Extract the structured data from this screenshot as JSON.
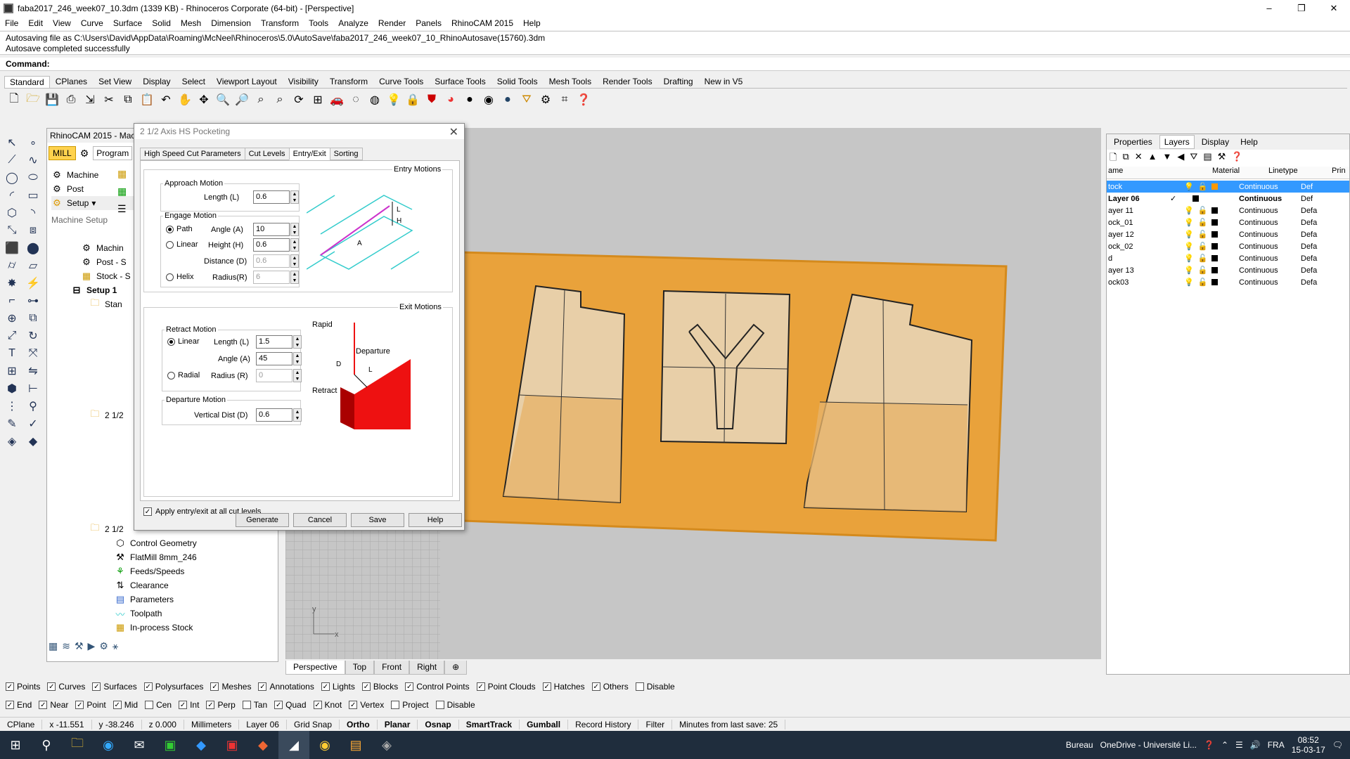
{
  "window": {
    "title": "faba2017_246_week07_10.3dm (1339 KB) - Rhinoceros Corporate (64-bit) - [Perspective]",
    "minimize": "–",
    "restore": "❐",
    "close": "✕"
  },
  "menu": [
    "File",
    "Edit",
    "View",
    "Curve",
    "Surface",
    "Solid",
    "Mesh",
    "Dimension",
    "Transform",
    "Tools",
    "Analyze",
    "Render",
    "Panels",
    "RhinoCAM 2015",
    "Help"
  ],
  "command_history": [
    "Autosaving file as C:\\Users\\David\\AppData\\Roaming\\McNeel\\Rhinoceros\\5.0\\AutoSave\\faba2017_246_week07_10_RhinoAutosave(15760).3dm",
    "Autosave completed successfully"
  ],
  "command_prompt": "Command:",
  "toolbar_tabs": [
    "Standard",
    "CPlanes",
    "Set View",
    "Display",
    "Select",
    "Viewport Layout",
    "Visibility",
    "Transform",
    "Curve Tools",
    "Surface Tools",
    "Solid Tools",
    "Mesh Tools",
    "Render Tools",
    "Drafting",
    "New in V5"
  ],
  "toolbar_icons": [
    "new-file-icon",
    "open-folder-icon",
    "save-icon",
    "print-icon",
    "import-icon",
    "cut-icon",
    "copy-icon",
    "paste-icon",
    "undo-icon",
    "pan-hand-icon",
    "move-icon",
    "zoom-icon",
    "zoom-window-icon",
    "zoom-extents-icon",
    "zoom-selected-icon",
    "rotate-view-icon",
    "four-viewports-icon",
    "car-icon",
    "hide-icon",
    "show-icon",
    "lightbulb-icon",
    "lock-icon",
    "shield-icon",
    "color-wheel-icon",
    "sphere-icon",
    "render-icon",
    "globe-icon",
    "filter-icon",
    "gear-icon",
    "grid-tools-icon",
    "help-icon"
  ],
  "rhinocam": {
    "title": "RhinoCAM 2015 - Mac",
    "mode_mill": "MILL",
    "tab_program": "Program",
    "machine": "Machine",
    "post": "Post",
    "setup": "Setup",
    "group_label": "Machine Setup",
    "tree_top": [
      "Machin",
      "Post - S",
      "Stock - S"
    ],
    "setup1": "Setup 1",
    "stan": "Stan",
    "node_21a": "2 1/2",
    "node_21b": "2 1/2",
    "tree_bottom": [
      "Control Geometry",
      "FlatMill 8mm_246",
      "Feeds/Speeds",
      "Clearance",
      "Parameters",
      "Toolpath",
      "In-process Stock"
    ]
  },
  "viewport_tabs": [
    "Perspective",
    "Top",
    "Front",
    "Right"
  ],
  "viewport_add": "⊕",
  "axis_y": "y",
  "axis_x": "x",
  "right_panel": {
    "tabs": [
      "Properties",
      "Layers",
      "Display",
      "Help"
    ],
    "columns": {
      "name": "ame",
      "material": "Material",
      "linetype": "Linetype",
      "print": "Prin"
    },
    "layers": [
      {
        "name": "tock",
        "linetype": "Continuous",
        "print": "Def"
      },
      {
        "name": "Layer 06",
        "linetype": "Continuous",
        "print": "Def"
      },
      {
        "name": "ayer 11",
        "linetype": "Continuous",
        "print": "Defa"
      },
      {
        "name": "ock_01",
        "linetype": "Continuous",
        "print": "Defa"
      },
      {
        "name": "ayer 12",
        "linetype": "Continuous",
        "print": "Defa"
      },
      {
        "name": "ock_02",
        "linetype": "Continuous",
        "print": "Defa"
      },
      {
        "name": "d",
        "linetype": "Continuous",
        "print": "Defa"
      },
      {
        "name": "ayer 13",
        "linetype": "Continuous",
        "print": "Defa"
      },
      {
        "name": "ock03",
        "linetype": "Continuous",
        "print": "Defa"
      }
    ]
  },
  "visibility_filters": [
    {
      "label": "Points",
      "checked": true
    },
    {
      "label": "Curves",
      "checked": true
    },
    {
      "label": "Surfaces",
      "checked": true
    },
    {
      "label": "Polysurfaces",
      "checked": true
    },
    {
      "label": "Meshes",
      "checked": true
    },
    {
      "label": "Annotations",
      "checked": true
    },
    {
      "label": "Lights",
      "checked": true
    },
    {
      "label": "Blocks",
      "checked": true
    },
    {
      "label": "Control Points",
      "checked": true
    },
    {
      "label": "Point Clouds",
      "checked": true
    },
    {
      "label": "Hatches",
      "checked": true
    },
    {
      "label": "Others",
      "checked": true
    },
    {
      "label": "Disable",
      "checked": false
    }
  ],
  "osnaps": [
    {
      "label": "End",
      "checked": true
    },
    {
      "label": "Near",
      "checked": true
    },
    {
      "label": "Point",
      "checked": true
    },
    {
      "label": "Mid",
      "checked": true
    },
    {
      "label": "Cen",
      "checked": false
    },
    {
      "label": "Int",
      "checked": true
    },
    {
      "label": "Perp",
      "checked": true
    },
    {
      "label": "Tan",
      "checked": false
    },
    {
      "label": "Quad",
      "checked": true
    },
    {
      "label": "Knot",
      "checked": true
    },
    {
      "label": "Vertex",
      "checked": true
    },
    {
      "label": "Project",
      "checked": false
    },
    {
      "label": "Disable",
      "checked": false
    }
  ],
  "status": {
    "cplane": "CPlane",
    "x": "x -11.551",
    "y": "y -38.246",
    "z": "z 0.000",
    "units": "Millimeters",
    "layer": "Layer 06",
    "grid_snap": "Grid Snap",
    "ortho": "Ortho",
    "planar": "Planar",
    "osnap": "Osnap",
    "smarttrack": "SmartTrack",
    "gumball": "Gumball",
    "record_history": "Record History",
    "filter": "Filter",
    "autosave": "Minutes from last save: 25"
  },
  "taskbar": {
    "bureau": "Bureau",
    "onedrive": "OneDrive - Université Li...",
    "lang": "FRA",
    "time": "08:52",
    "date": "15-03-17"
  },
  "dialog": {
    "title": "2 1/2 Axis HS Pocketing",
    "tabs": [
      "High Speed Cut Parameters",
      "Cut Levels",
      "Entry/Exit",
      "Sorting"
    ],
    "entry_motions": "Entry Motions",
    "approach_motion": "Approach Motion",
    "approach_length_label": "Length (L)",
    "approach_length": "0.6",
    "engage_motion": "Engage Motion",
    "path": "Path",
    "linear": "Linear",
    "helix": "Helix",
    "angle_label": "Angle (A)",
    "angle": "10",
    "height_label": "Height (H)",
    "height": "0.6",
    "distance_label": "Distance (D)",
    "distance": "0.6",
    "radius_label": "Radius(R)",
    "radius": "6",
    "exit_motions": "Exit Motions",
    "retract_motion": "Retract Motion",
    "retract_linear": "Linear",
    "retract_radial": "Radial",
    "retract_length_label": "Length (L)",
    "retract_length": "1.5",
    "retract_angle_label": "Angle (A)",
    "retract_angle": "45",
    "retract_radius_label": "Radius (R)",
    "retract_radius": "0",
    "departure_motion": "Departure Motion",
    "vertical_dist_label": "Vertical Dist (D)",
    "vertical_dist": "0.6",
    "apply_all": "Apply entry/exit at all cut levels",
    "diagram_L": "L",
    "diagram_H": "H",
    "diagram_A": "A",
    "diagram_rapid": "Rapid",
    "diagram_departure": "Departure",
    "diagram_retract": "Retract",
    "diagram_D": "D",
    "buttons": {
      "generate": "Generate",
      "cancel": "Cancel",
      "save": "Save",
      "help": "Help"
    }
  }
}
